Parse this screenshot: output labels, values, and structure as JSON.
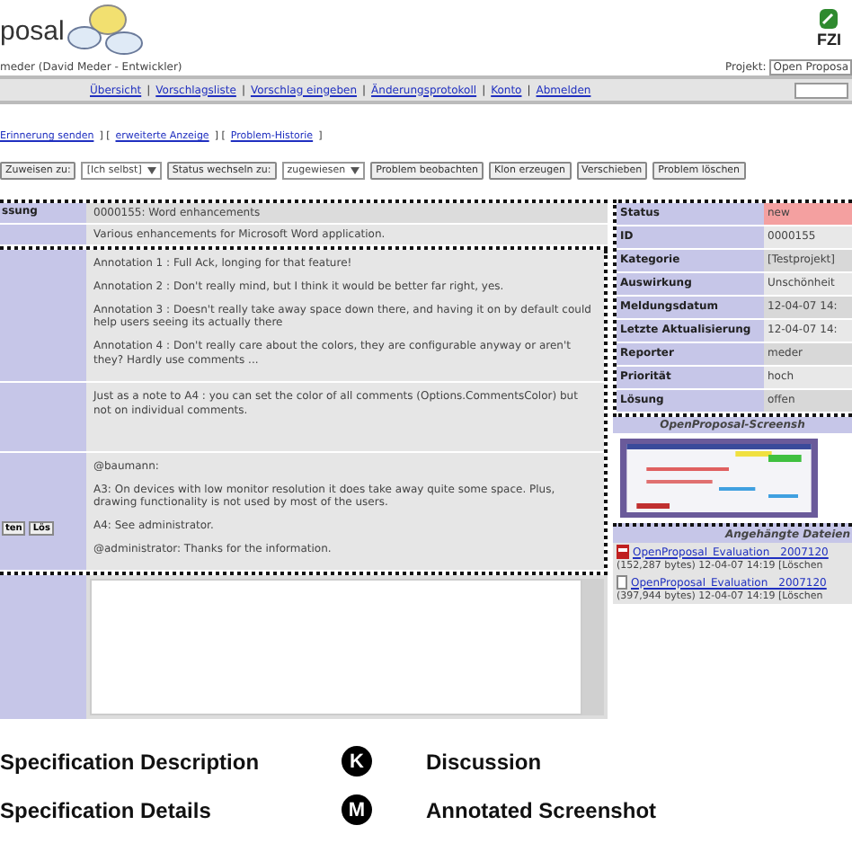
{
  "header": {
    "logo_text": "posal",
    "user": "meder (David Meder - Entwickler)",
    "project_label": "Projekt:",
    "project_value": "Open Proposa",
    "org": "FZI"
  },
  "nav": {
    "links": [
      "Übersicht",
      "Vorschlagsliste",
      "Vorschlag eingeben",
      "Änderungsprotokoll",
      "Konto",
      "Abmelden"
    ],
    "separator": "|"
  },
  "action_links": [
    "Erinnerung senden",
    "erweiterte Anzeige",
    "Problem-Historie"
  ],
  "action_separator": "] [",
  "action_end": "]",
  "toolbar": [
    {
      "kind": "button",
      "label": "Zuweisen zu:"
    },
    {
      "kind": "select",
      "label": "[Ich selbst]"
    },
    {
      "kind": "button",
      "label": "Status wechseln zu:"
    },
    {
      "kind": "select",
      "label": "zugewiesen"
    },
    {
      "kind": "button",
      "label": "Problem beobachten"
    },
    {
      "kind": "button",
      "label": "Klon erzeugen"
    },
    {
      "kind": "button",
      "label": "Verschieben"
    },
    {
      "kind": "button",
      "label": "Problem löschen"
    }
  ],
  "summary": {
    "label": "ssung",
    "title": "0000155: Word enhancements",
    "description": "Various enhancements for Microsoft Word application."
  },
  "annotations": [
    "Annotation 1 : Full Ack, longing for that feature!",
    "Annotation 2 : Don't really mind, but I think it would be better far right, yes.",
    "Annotation 3 : Doesn't really take away space down there, and having it on by default could help users seeing its actually there",
    "Annotation 4 : Don't really care about the colors, they are configurable anyway or aren't they? Hardly use comments ..."
  ],
  "note": "Just as a note to A4 : you can set the color of all comments (Options.CommentsColor) but not on individual comments.",
  "comment": {
    "buttons": [
      "ten",
      "Lös"
    ],
    "paragraphs": [
      "@baumann:",
      "A3: On devices with low monitor resolution it does take away quite some space. Plus, drawing functionality is not used by most of the users.",
      "A4: See administrator.",
      "@administrator: Thanks for the information."
    ]
  },
  "details": [
    {
      "label": "Status",
      "value": "new",
      "color": "#f4a0a0"
    },
    {
      "label": "ID",
      "value": "0000155",
      "color": "#e8e8e8"
    },
    {
      "label": "Kategorie",
      "value": "[Testprojekt]",
      "color": "#d8d8d8"
    },
    {
      "label": "Auswirkung",
      "value": "Unschönheit",
      "color": "#e8e8e8"
    },
    {
      "label": "Meldungsdatum",
      "value": "12-04-07 14:",
      "color": "#d8d8d8"
    },
    {
      "label": "Letzte Aktualisierung",
      "value": "12-04-07 14:",
      "color": "#e8e8e8"
    },
    {
      "label": "Reporter",
      "value": "meder",
      "color": "#d8d8d8"
    },
    {
      "label": "Priorität",
      "value": "hoch",
      "color": "#e8e8e8"
    },
    {
      "label": "Lösung",
      "value": "offen",
      "color": "#d8d8d8"
    }
  ],
  "screenshot_header": "OpenProposal-Screensh",
  "attachments_header": "Angehängte Dateien",
  "attachments": [
    {
      "kind": "pdf",
      "name": "OpenProposal_Evaluation__2007120",
      "info": "(152,287 bytes) 12-04-07 14:19 [Löschen"
    },
    {
      "kind": "doc",
      "name": "OpenProposal_Evaluation__2007120",
      "info": "(397,944 bytes) 12-04-07 14:19 [Löschen"
    }
  ],
  "legend": [
    {
      "left": "Specification Description",
      "marker": "K",
      "right": "Discussion"
    },
    {
      "left": "Specification Details",
      "marker": "M",
      "right": "Annotated Screenshot"
    }
  ]
}
